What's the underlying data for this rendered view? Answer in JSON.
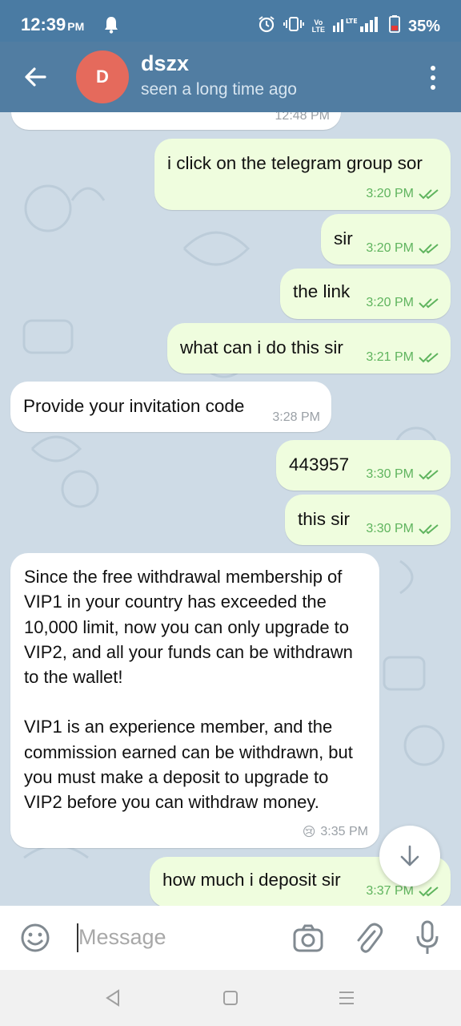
{
  "status_bar": {
    "time": "12:39",
    "ampm": "PM",
    "network_vo": "Vo",
    "network_lte": "LTE",
    "battery": "35%",
    "icons": [
      "bell-icon",
      "alarm-icon",
      "vibrate-icon",
      "signal-icon",
      "battery-icon"
    ]
  },
  "header": {
    "avatar_letter": "D",
    "name": "dszx",
    "status": "seen a long time ago",
    "avatar_color": "#e56a5c",
    "bar_color": "#517da2"
  },
  "messages": {
    "prev_time": "12:48 PM",
    "m1": {
      "text": "i click on the telegram group sor",
      "time": "3:20 PM"
    },
    "m2": {
      "text": "sir",
      "time": "3:20 PM"
    },
    "m3": {
      "text": "the link",
      "time": "3:20 PM"
    },
    "m4": {
      "text": "what can i do this sir",
      "time": "3:21 PM"
    },
    "m5": {
      "text": "Provide your invitation code",
      "time": "3:28 PM"
    },
    "m6": {
      "text": "443957",
      "time": "3:30 PM"
    },
    "m7": {
      "text": "this sir",
      "time": "3:30 PM"
    },
    "m8": {
      "para1": "Since the free withdrawal membership of VIP1 in your country has exceeded the 10,000 limit, now you can only upgrade to VIP2, and all your funds can be withdrawn to the wallet!",
      "para2": "VIP1 is an experience member, and the commission earned can be withdrawn, but you must make a deposit to upgrade to VIP2 before you can withdraw money.",
      "reaction": "😢",
      "time": "3:35 PM"
    },
    "m9": {
      "text": "how much i deposit sir",
      "time": "3:37 PM"
    }
  },
  "input": {
    "placeholder": "Message"
  },
  "colors": {
    "outgoing_bubble": "#effdde",
    "incoming_bubble": "#ffffff",
    "tick_green": "#5fb45e",
    "chat_bg": "#cedbe6"
  }
}
